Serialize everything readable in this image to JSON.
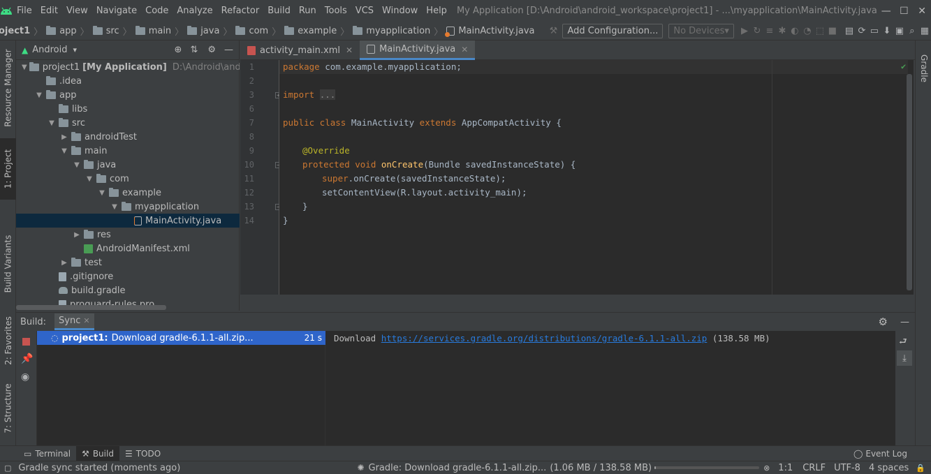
{
  "menu": [
    "File",
    "Edit",
    "View",
    "Navigate",
    "Code",
    "Analyze",
    "Refactor",
    "Build",
    "Run",
    "Tools",
    "VCS",
    "Window",
    "Help"
  ],
  "window_title": "My Application [D:\\Android\\android_workspace\\project1] - ...\\myapplication\\MainActivity.java",
  "breadcrumbs": [
    "oject1",
    "app",
    "src",
    "main",
    "java",
    "com",
    "example",
    "myapplication",
    "MainActivity.java"
  ],
  "toolbar": {
    "add_configuration": "Add Configuration...",
    "no_devices": "No Devices"
  },
  "left_tabs": {
    "resource_manager": "Resource Manager",
    "project": "1: Project",
    "build_variants": "Build Variants",
    "favorites": "2: Favorites",
    "structure": "7: Structure"
  },
  "right_tabs": {
    "gradle": "Gradle"
  },
  "project_panel": {
    "view_selector": "Android",
    "tree": [
      {
        "label": "project1",
        "bold_suffix": "[My Application]",
        "path": "D:\\Android\\android_",
        "depth": 0,
        "arrow": "open",
        "icon": "folder"
      },
      {
        "label": ".idea",
        "depth": 1,
        "arrow": "none",
        "icon": "folder"
      },
      {
        "label": "app",
        "depth": 1,
        "arrow": "open",
        "icon": "folder"
      },
      {
        "label": "libs",
        "depth": 2,
        "arrow": "none",
        "icon": "folder"
      },
      {
        "label": "src",
        "depth": 2,
        "arrow": "open",
        "icon": "folder"
      },
      {
        "label": "androidTest",
        "depth": 3,
        "arrow": "closed",
        "icon": "folder"
      },
      {
        "label": "main",
        "depth": 3,
        "arrow": "open",
        "icon": "folder"
      },
      {
        "label": "java",
        "depth": 4,
        "arrow": "open",
        "icon": "folder"
      },
      {
        "label": "com",
        "depth": 5,
        "arrow": "open",
        "icon": "folder"
      },
      {
        "label": "example",
        "depth": 6,
        "arrow": "open",
        "icon": "folder"
      },
      {
        "label": "myapplication",
        "depth": 7,
        "arrow": "open",
        "icon": "folder"
      },
      {
        "label": "MainActivity.java",
        "depth": 8,
        "arrow": "none",
        "icon": "java",
        "selected": true
      },
      {
        "label": "res",
        "depth": 4,
        "arrow": "closed",
        "icon": "folder"
      },
      {
        "label": "AndroidManifest.xml",
        "depth": 4,
        "arrow": "none",
        "icon": "manifest"
      },
      {
        "label": "test",
        "depth": 3,
        "arrow": "closed",
        "icon": "folder"
      },
      {
        "label": ".gitignore",
        "depth": 2,
        "arrow": "none",
        "icon": "file"
      },
      {
        "label": "build.gradle",
        "depth": 2,
        "arrow": "none",
        "icon": "gradle"
      },
      {
        "label": "proguard-rules.pro",
        "depth": 2,
        "arrow": "none",
        "icon": "file"
      }
    ]
  },
  "editor": {
    "tabs": [
      {
        "label": "activity_main.xml",
        "active": false
      },
      {
        "label": "MainActivity.java",
        "active": true
      }
    ],
    "line_numbers": [
      "1",
      "2",
      "3",
      "6",
      "7",
      "8",
      "9",
      "10",
      "11",
      "12",
      "13",
      "14"
    ],
    "code": {
      "l1_kw": "package",
      "l1_rest": " com.example.myapplication;",
      "l3_kw": "import",
      "l3_fold": "...",
      "l7_kw1": "public class",
      "l7_name": " MainActivity ",
      "l7_kw2": "extends",
      "l7_rest": " AppCompatActivity {",
      "l9_ann": "@Override",
      "l10_kw": "protected void",
      "l10_fn": " onCreate",
      "l10_rest": "(Bundle savedInstanceState) {",
      "l11_kw": "super",
      "l11_rest": ".onCreate(savedInstanceState);",
      "l12": "setContentView(R.layout.activity_main);",
      "l13": "}",
      "l14": "}"
    }
  },
  "build": {
    "label": "Build:",
    "tab": "Sync",
    "task_name": "project1:",
    "task_desc": "Download gradle-6.1.1-all.zip...",
    "task_time": "21 s",
    "output_prefix": "Download ",
    "output_link": "https://services.gradle.org/distributions/gradle-6.1.1-all.zip",
    "output_suffix": " (138.58 MB)"
  },
  "bottom_tabs": {
    "terminal": "Terminal",
    "build": "Build",
    "todo": "TODO",
    "event_log": "Event Log"
  },
  "status": {
    "message": "Gradle sync started (moments ago)",
    "progress_text": "Gradle: Download gradle-6.1.1-all.zip...",
    "progress_size": "(1.06 MB / 138.58 MB)",
    "progress_fraction": 0.0076,
    "position": "1:1",
    "line_sep": "CRLF",
    "encoding": "UTF-8",
    "indent": "4 spaces"
  },
  "colors": {
    "accent": "#4a88c7",
    "selection": "#0d293e",
    "keyword": "#cc7832",
    "annotation": "#bbb529",
    "function": "#ffc66d",
    "link": "#287bde",
    "android_green": "#3ddc84"
  }
}
